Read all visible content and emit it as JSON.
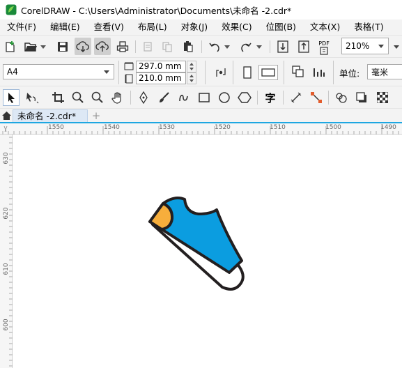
{
  "window": {
    "title": "CorelDRAW - C:\\Users\\Administrator\\Documents\\未命名 -2.cdr*"
  },
  "menu": [
    "文件(F)",
    "编辑(E)",
    "查看(V)",
    "布局(L)",
    "对象(J)",
    "效果(C)",
    "位图(B)",
    "文本(X)",
    "表格(T)"
  ],
  "toolbar": {
    "zoom": "210%",
    "pdf_label": "PDF"
  },
  "property_bar": {
    "page_size": "A4",
    "width": "297.0 mm",
    "height": "210.0 mm",
    "unit_label": "单位:",
    "unit_value": "毫米"
  },
  "tools": {
    "text_tool": "字"
  },
  "document_tab": {
    "label": "未命名 -2.cdr*",
    "add_label": "+"
  },
  "ruler": {
    "horizontal": [
      "1550",
      "1540",
      "1530",
      "1520",
      "1510",
      "1500",
      "1490"
    ],
    "vertical": [
      "630",
      "620",
      "610",
      "600"
    ]
  },
  "colors": {
    "shoe_blue": "#0b9de0",
    "shoe_orange": "#f7ae3c",
    "outline": "#231f20",
    "ruler_accent": "#1ea7e1"
  }
}
